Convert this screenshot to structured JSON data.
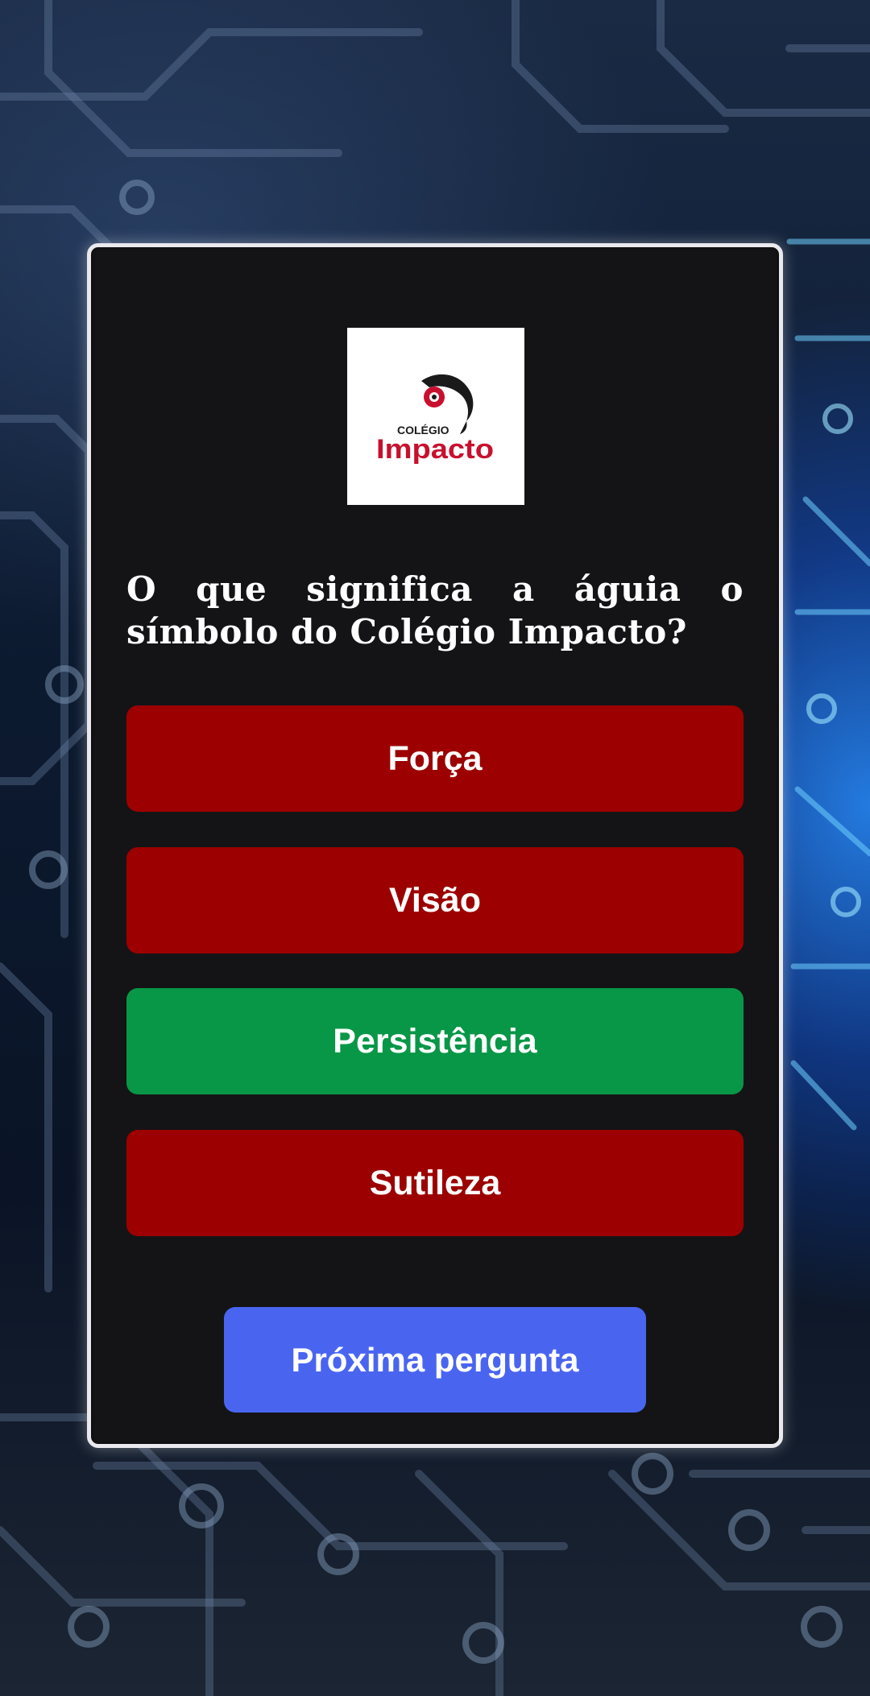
{
  "logo": {
    "icon": "eagle-icon",
    "line1": "COLÉGIO",
    "line2": "Impacto",
    "brand_red": "#c8102e"
  },
  "quiz": {
    "question": "O que significa a águia o símbolo do Colégio Impacto?",
    "answers": [
      {
        "label": "Força",
        "state": "wrong",
        "color": "#9c0000"
      },
      {
        "label": "Visão",
        "state": "wrong",
        "color": "#9c0000"
      },
      {
        "label": "Persistência",
        "state": "correct",
        "color": "#089747"
      },
      {
        "label": "Sutileza",
        "state": "wrong",
        "color": "#9c0000"
      }
    ],
    "next_label": "Próxima pergunta",
    "next_color": "#4965f0"
  },
  "background": {
    "icon": "circuit-board-background"
  }
}
